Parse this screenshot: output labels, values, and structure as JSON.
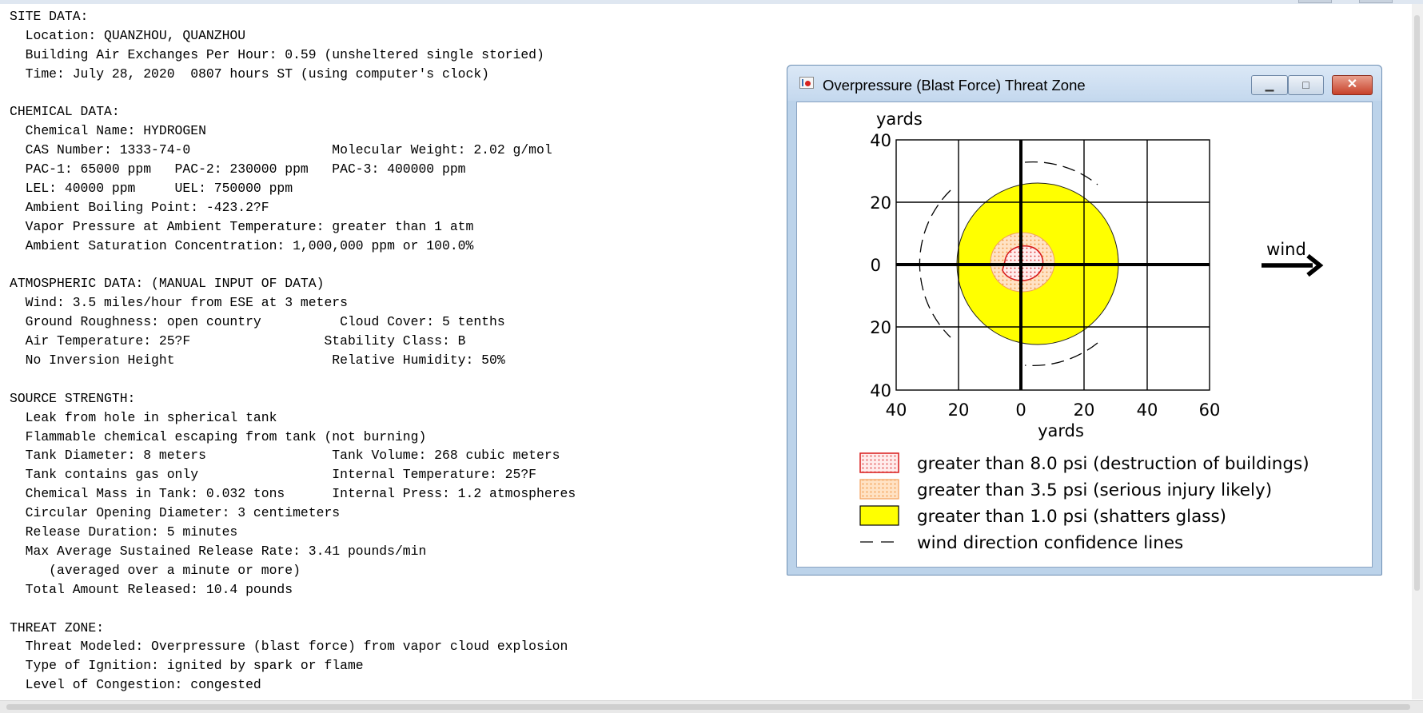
{
  "report": {
    "lines": [
      "SITE DATA:",
      "  Location: QUANZHOU, QUANZHOU",
      "  Building Air Exchanges Per Hour: 0.59 (unsheltered single storied)",
      "  Time: July 28, 2020  0807 hours ST (using computer's clock)",
      "",
      "CHEMICAL DATA:",
      "  Chemical Name: HYDROGEN",
      "  CAS Number: 1333-74-0                  Molecular Weight: 2.02 g/mol",
      "  PAC-1: 65000 ppm   PAC-2: 230000 ppm   PAC-3: 400000 ppm",
      "  LEL: 40000 ppm     UEL: 750000 ppm",
      "  Ambient Boiling Point: -423.2?F",
      "  Vapor Pressure at Ambient Temperature: greater than 1 atm",
      "  Ambient Saturation Concentration: 1,000,000 ppm or 100.0%",
      "",
      "ATMOSPHERIC DATA: (MANUAL INPUT OF DATA)",
      "  Wind: 3.5 miles/hour from ESE at 3 meters",
      "  Ground Roughness: open country          Cloud Cover: 5 tenths",
      "  Air Temperature: 25?F                 Stability Class: B",
      "  No Inversion Height                    Relative Humidity: 50%",
      "",
      "SOURCE STRENGTH:",
      "  Leak from hole in spherical tank",
      "  Flammable chemical escaping from tank (not burning)",
      "  Tank Diameter: 8 meters                Tank Volume: 268 cubic meters",
      "  Tank contains gas only                 Internal Temperature: 25?F",
      "  Chemical Mass in Tank: 0.032 tons      Internal Press: 1.2 atmospheres",
      "  Circular Opening Diameter: 3 centimeters",
      "  Release Duration: 5 minutes",
      "  Max Average Sustained Release Rate: 3.41 pounds/min",
      "     (averaged over a minute or more)",
      "  Total Amount Released: 10.4 pounds",
      "",
      "THREAT ZONE:",
      "  Threat Modeled: Overpressure (blast force) from vapor cloud explosion",
      "  Type of Ignition: ignited by spark or flame",
      "  Level of Congestion: congested"
    ]
  },
  "window": {
    "title": "Overpressure (Blast Force) Threat Zone",
    "minimize_glyph": "▁",
    "maximize_glyph": "□",
    "close_glyph": "✕"
  },
  "plot": {
    "y_unit": "yards",
    "x_unit": "yards",
    "wind_label": "wind",
    "x_ticks": [
      "40",
      "20",
      "0",
      "20",
      "40",
      "60"
    ],
    "y_ticks": [
      "40",
      "20",
      "0",
      "20",
      "40"
    ],
    "legend": [
      {
        "label": "greater than 8.0 psi (destruction of buildings)",
        "color": "#e0231c"
      },
      {
        "label": "greater than 3.5 psi (serious injury likely)",
        "color": "#f39c4a"
      },
      {
        "label": "greater than 1.0 psi (shatters glass)",
        "color": "#ffff00"
      },
      {
        "label": "wind direction confidence lines",
        "color": "#000000"
      }
    ]
  }
}
